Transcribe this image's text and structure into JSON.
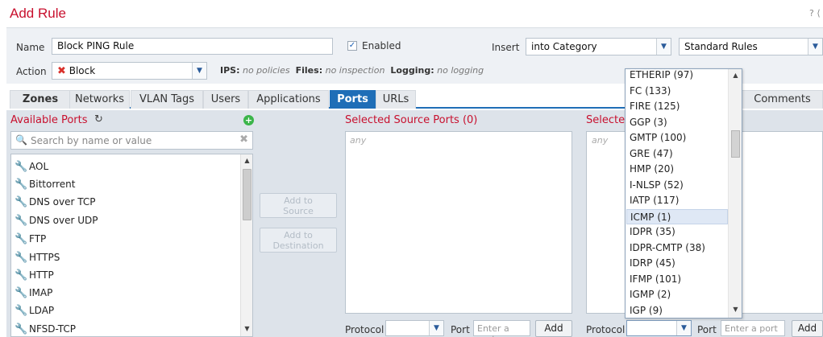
{
  "title": "Add Rule",
  "help": "? ⟨",
  "form": {
    "name_label": "Name",
    "name_value": "Block PING Rule",
    "enabled_label": "Enabled",
    "insert_label": "Insert",
    "insert_value": "into Category",
    "category_value": "Standard Rules",
    "action_label": "Action",
    "action_value": "Block",
    "ips_label": "IPS:",
    "ips_value": "no policies",
    "files_label": "Files:",
    "files_value": "no inspection",
    "logging_label": "Logging:",
    "logging_value": "no logging"
  },
  "tabs": [
    "Zones",
    "Networks",
    "VLAN Tags",
    "Users",
    "Applications",
    "Ports",
    "URLs",
    "Comments"
  ],
  "active_tab": "Ports",
  "available": {
    "title": "Available Ports",
    "search_placeholder": "Search by name or value",
    "items": [
      "AOL",
      "Bittorrent",
      "DNS over TCP",
      "DNS over UDP",
      "FTP",
      "HTTPS",
      "HTTP",
      "IMAP",
      "LDAP",
      "NFSD-TCP"
    ]
  },
  "buttons": {
    "add_to_source": [
      "Add to",
      "Source"
    ],
    "add_to_destination": [
      "Add to",
      "Destination"
    ]
  },
  "selected_source": {
    "title": "Selected Source Ports (0)",
    "empty": "any",
    "protocol_label": "Protocol",
    "port_label": "Port",
    "port_placeholder": "Enter a port",
    "add_label": "Add"
  },
  "selected_destination": {
    "title_visible": "Selecte",
    "empty": "any",
    "protocol_label": "Protocol",
    "port_label": "Port",
    "port_placeholder": "Enter a port",
    "add_label": "Add"
  },
  "protocol_dropdown": {
    "options": [
      "ETHERIP (97)",
      "FC (133)",
      "FIRE (125)",
      "GGP (3)",
      "GMTP (100)",
      "GRE (47)",
      "HMP (20)",
      "I-NLSP (52)",
      "IATP (117)",
      "ICMP (1)",
      "IDPR (35)",
      "IDPR-CMTP (38)",
      "IDRP (45)",
      "IFMP (101)",
      "IGMP (2)",
      "IGP (9)"
    ],
    "highlighted": "ICMP (1)"
  },
  "colors": {
    "accent": "#1f6eb7",
    "title_red": "#c8102e",
    "panel": "#dde3ea"
  }
}
